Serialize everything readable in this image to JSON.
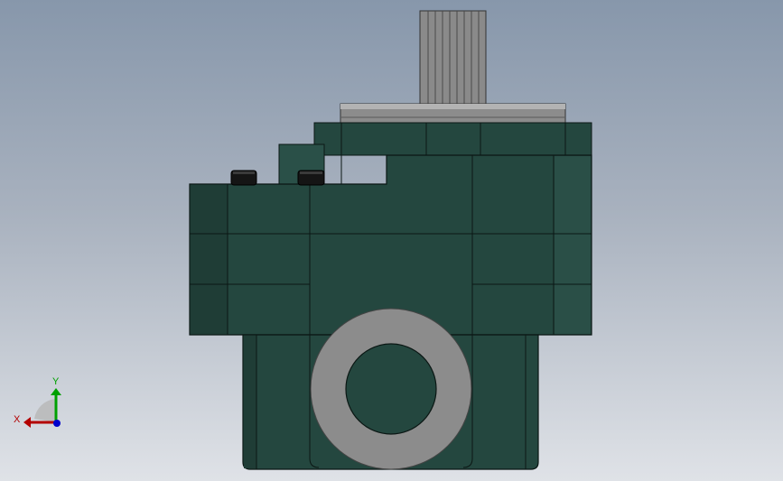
{
  "viewport": {
    "background_top": "#8797ab",
    "background_bottom": "#dfe2e7"
  },
  "model": {
    "part": "gear-pump",
    "view": "front",
    "body_color": "#24473f",
    "edge_color": "#0b1714",
    "flange_color": "#8c8c8c",
    "shaft_color": "#8a8a8a",
    "bolt_color": "#151515"
  },
  "triad": {
    "x_label": "X",
    "y_label": "Y",
    "x_color": "#b30000",
    "y_color": "#00a000",
    "z_color": "#0000cc"
  }
}
